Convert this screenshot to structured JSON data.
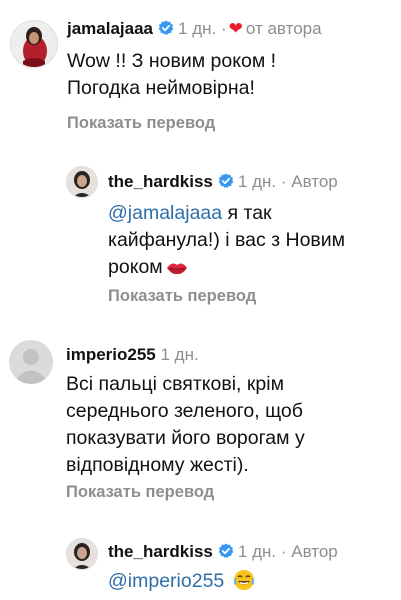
{
  "comments": [
    {
      "username": "jamalajaaa",
      "verified": true,
      "time": "1 дн.",
      "separator": "·",
      "liked_by_author": "от автора",
      "text": "Wow !! З новим роком ! Погодка неймовірна!",
      "translate_label": "Показать перевод"
    },
    {
      "username": "the_hardkiss",
      "verified": true,
      "time": "1 дн.",
      "separator": "·",
      "author_badge": "Автор",
      "mention": "@jamalajaaa",
      "text": " я так кайфанула!) і вас з Новим роком",
      "emoji": "kiss-mark",
      "translate_label": "Показать перевод"
    },
    {
      "username": "imperio255",
      "verified": false,
      "time": "1 дн.",
      "text": "Всі пальці святкові, крім середнього зеленого, щоб показувати його ворогам у відповідному жесті).",
      "translate_label": "Показать перевод"
    },
    {
      "username": "the_hardkiss",
      "verified": true,
      "time": "1 дн.",
      "separator": "·",
      "author_badge": "Автор",
      "mention": "@imperio255",
      "text": " ",
      "emoji": "tears-of-joy"
    }
  ],
  "colors": {
    "text": "#111111",
    "meta": "#8e8e8e",
    "mention": "#2e6ea8",
    "verified": "#3897f0",
    "heart": "#ed1c2e"
  }
}
